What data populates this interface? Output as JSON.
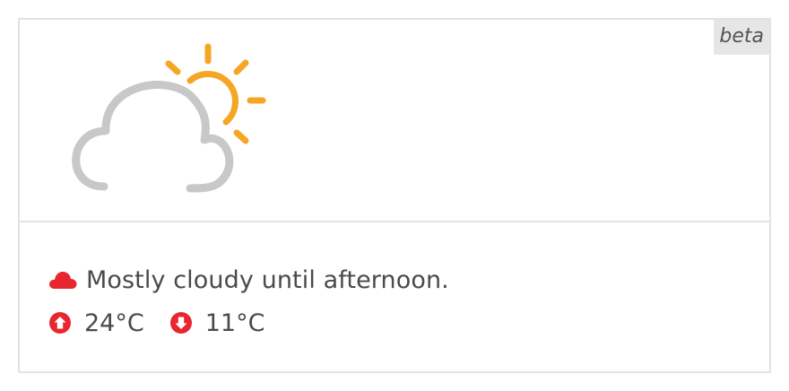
{
  "badge": {
    "label": "beta"
  },
  "weather": {
    "icon": "partly-cloudy-day-icon",
    "summary": "Mostly cloudy until afternoon.",
    "summary_icon": "cloud-icon",
    "high": {
      "icon": "arrow-up-circle-icon",
      "value": "24°C"
    },
    "low": {
      "icon": "arrow-down-circle-icon",
      "value": "11°C"
    }
  },
  "colors": {
    "accent_red": "#e8262f",
    "sun_orange": "#f5a623",
    "cloud_gray": "#c8c8c8",
    "border": "#e3e3e3"
  }
}
